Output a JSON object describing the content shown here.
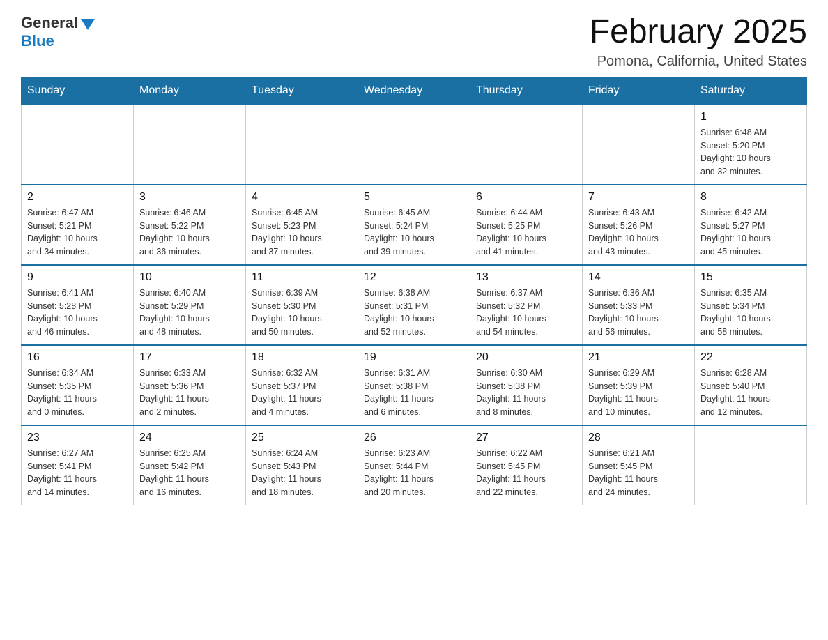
{
  "logo": {
    "general": "General",
    "blue": "Blue"
  },
  "title": "February 2025",
  "location": "Pomona, California, United States",
  "weekdays": [
    "Sunday",
    "Monday",
    "Tuesday",
    "Wednesday",
    "Thursday",
    "Friday",
    "Saturday"
  ],
  "weeks": [
    [
      {
        "day": "",
        "info": ""
      },
      {
        "day": "",
        "info": ""
      },
      {
        "day": "",
        "info": ""
      },
      {
        "day": "",
        "info": ""
      },
      {
        "day": "",
        "info": ""
      },
      {
        "day": "",
        "info": ""
      },
      {
        "day": "1",
        "info": "Sunrise: 6:48 AM\nSunset: 5:20 PM\nDaylight: 10 hours\nand 32 minutes."
      }
    ],
    [
      {
        "day": "2",
        "info": "Sunrise: 6:47 AM\nSunset: 5:21 PM\nDaylight: 10 hours\nand 34 minutes."
      },
      {
        "day": "3",
        "info": "Sunrise: 6:46 AM\nSunset: 5:22 PM\nDaylight: 10 hours\nand 36 minutes."
      },
      {
        "day": "4",
        "info": "Sunrise: 6:45 AM\nSunset: 5:23 PM\nDaylight: 10 hours\nand 37 minutes."
      },
      {
        "day": "5",
        "info": "Sunrise: 6:45 AM\nSunset: 5:24 PM\nDaylight: 10 hours\nand 39 minutes."
      },
      {
        "day": "6",
        "info": "Sunrise: 6:44 AM\nSunset: 5:25 PM\nDaylight: 10 hours\nand 41 minutes."
      },
      {
        "day": "7",
        "info": "Sunrise: 6:43 AM\nSunset: 5:26 PM\nDaylight: 10 hours\nand 43 minutes."
      },
      {
        "day": "8",
        "info": "Sunrise: 6:42 AM\nSunset: 5:27 PM\nDaylight: 10 hours\nand 45 minutes."
      }
    ],
    [
      {
        "day": "9",
        "info": "Sunrise: 6:41 AM\nSunset: 5:28 PM\nDaylight: 10 hours\nand 46 minutes."
      },
      {
        "day": "10",
        "info": "Sunrise: 6:40 AM\nSunset: 5:29 PM\nDaylight: 10 hours\nand 48 minutes."
      },
      {
        "day": "11",
        "info": "Sunrise: 6:39 AM\nSunset: 5:30 PM\nDaylight: 10 hours\nand 50 minutes."
      },
      {
        "day": "12",
        "info": "Sunrise: 6:38 AM\nSunset: 5:31 PM\nDaylight: 10 hours\nand 52 minutes."
      },
      {
        "day": "13",
        "info": "Sunrise: 6:37 AM\nSunset: 5:32 PM\nDaylight: 10 hours\nand 54 minutes."
      },
      {
        "day": "14",
        "info": "Sunrise: 6:36 AM\nSunset: 5:33 PM\nDaylight: 10 hours\nand 56 minutes."
      },
      {
        "day": "15",
        "info": "Sunrise: 6:35 AM\nSunset: 5:34 PM\nDaylight: 10 hours\nand 58 minutes."
      }
    ],
    [
      {
        "day": "16",
        "info": "Sunrise: 6:34 AM\nSunset: 5:35 PM\nDaylight: 11 hours\nand 0 minutes."
      },
      {
        "day": "17",
        "info": "Sunrise: 6:33 AM\nSunset: 5:36 PM\nDaylight: 11 hours\nand 2 minutes."
      },
      {
        "day": "18",
        "info": "Sunrise: 6:32 AM\nSunset: 5:37 PM\nDaylight: 11 hours\nand 4 minutes."
      },
      {
        "day": "19",
        "info": "Sunrise: 6:31 AM\nSunset: 5:38 PM\nDaylight: 11 hours\nand 6 minutes."
      },
      {
        "day": "20",
        "info": "Sunrise: 6:30 AM\nSunset: 5:38 PM\nDaylight: 11 hours\nand 8 minutes."
      },
      {
        "day": "21",
        "info": "Sunrise: 6:29 AM\nSunset: 5:39 PM\nDaylight: 11 hours\nand 10 minutes."
      },
      {
        "day": "22",
        "info": "Sunrise: 6:28 AM\nSunset: 5:40 PM\nDaylight: 11 hours\nand 12 minutes."
      }
    ],
    [
      {
        "day": "23",
        "info": "Sunrise: 6:27 AM\nSunset: 5:41 PM\nDaylight: 11 hours\nand 14 minutes."
      },
      {
        "day": "24",
        "info": "Sunrise: 6:25 AM\nSunset: 5:42 PM\nDaylight: 11 hours\nand 16 minutes."
      },
      {
        "day": "25",
        "info": "Sunrise: 6:24 AM\nSunset: 5:43 PM\nDaylight: 11 hours\nand 18 minutes."
      },
      {
        "day": "26",
        "info": "Sunrise: 6:23 AM\nSunset: 5:44 PM\nDaylight: 11 hours\nand 20 minutes."
      },
      {
        "day": "27",
        "info": "Sunrise: 6:22 AM\nSunset: 5:45 PM\nDaylight: 11 hours\nand 22 minutes."
      },
      {
        "day": "28",
        "info": "Sunrise: 6:21 AM\nSunset: 5:45 PM\nDaylight: 11 hours\nand 24 minutes."
      },
      {
        "day": "",
        "info": ""
      }
    ]
  ]
}
